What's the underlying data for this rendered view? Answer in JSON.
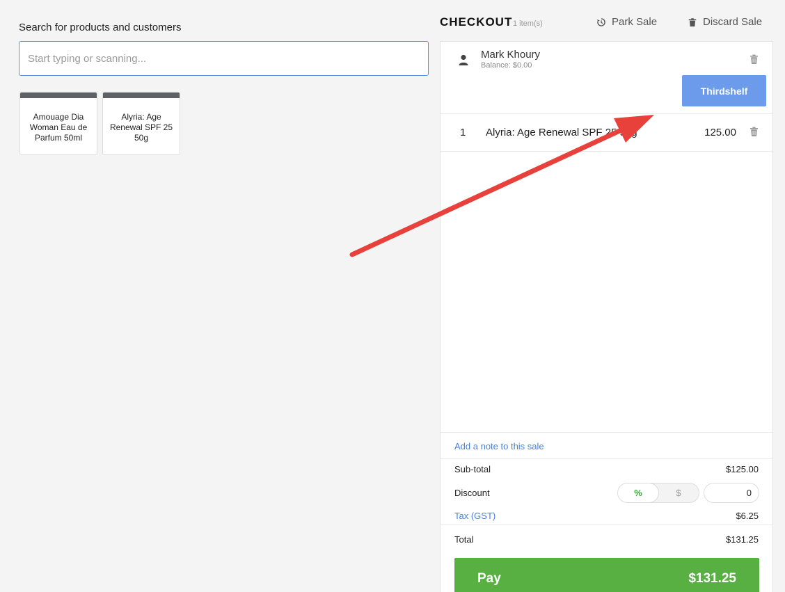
{
  "search": {
    "label": "Search for products and customers",
    "placeholder": "Start typing or scanning..."
  },
  "products": [
    {
      "name": "Amouage Dia Woman Eau de Parfum 50ml"
    },
    {
      "name": "Alyria: Age Renewal SPF 25 50g"
    }
  ],
  "checkout": {
    "title": "CHECKOUT",
    "item_count": "1 item(s)",
    "park_label": "Park Sale",
    "discard_label": "Discard Sale"
  },
  "customer": {
    "name": "Mark Khoury",
    "balance": "Balance: $0.00",
    "loyalty_button": "Thirdshelf"
  },
  "line_items": [
    {
      "qty": "1",
      "name": "Alyria: Age Renewal SPF 25 50g",
      "price": "125.00"
    }
  ],
  "note_link": "Add a note to this sale",
  "summary": {
    "subtotal_label": "Sub-total",
    "subtotal_value": "$125.00",
    "discount_label": "Discount",
    "discount_percent": "%",
    "discount_dollar": "$",
    "discount_value": "0",
    "tax_label": "Tax (GST)",
    "tax_value": "$6.25",
    "total_label": "Total",
    "total_value": "$131.25"
  },
  "pay": {
    "label": "Pay",
    "amount": "$131.25"
  },
  "colors": {
    "accent_blue": "#6b9bea",
    "pay_green": "#58b043",
    "annotation_red": "#e8413c"
  },
  "icons": {
    "park": "history-icon",
    "discard": "trash-icon",
    "customer": "person-icon"
  }
}
